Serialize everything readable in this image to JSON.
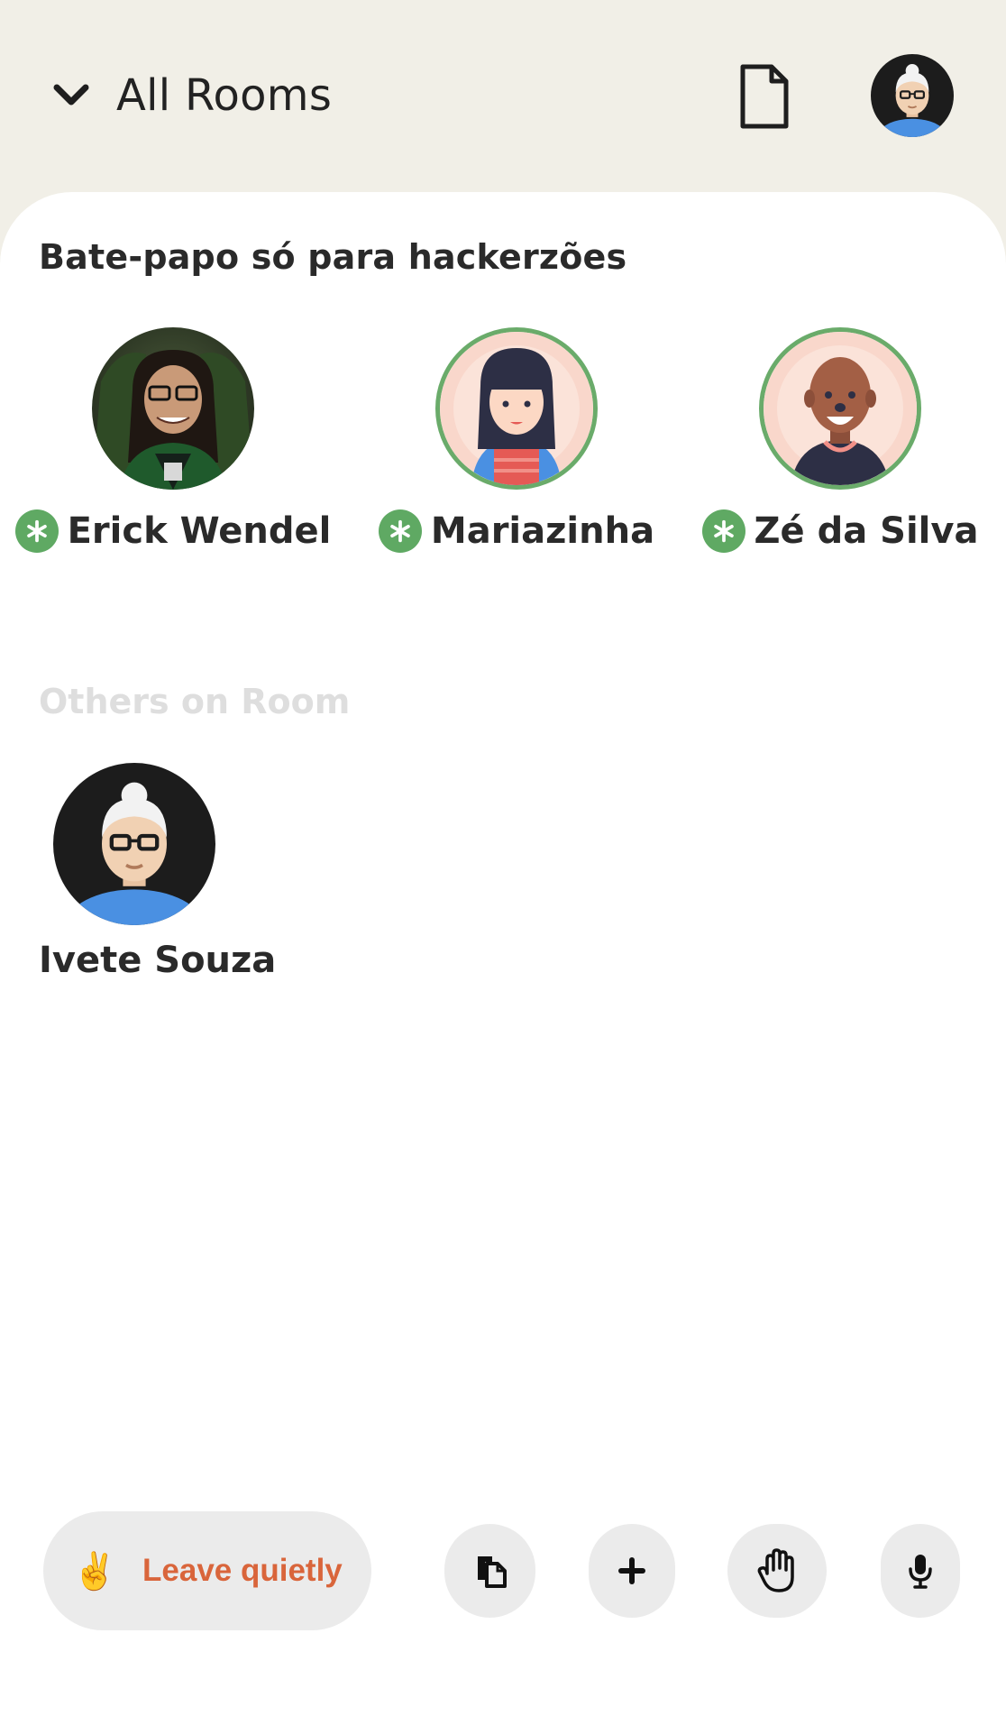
{
  "header": {
    "title": "All Rooms",
    "toggle_icon": "chevron-down-icon",
    "document_icon": "document-icon",
    "profile_avatar": "avatar-ivete-souza"
  },
  "room": {
    "title": "Bate-papo só para hackerzões",
    "speakers": [
      {
        "name": "Erick Wendel",
        "moderator": true
      },
      {
        "name": "Mariazinha",
        "moderator": true
      },
      {
        "name": "Zé da Silva",
        "moderator": true
      }
    ],
    "others_title": "Others on Room",
    "listeners": [
      {
        "name": "Ivete Souza"
      }
    ]
  },
  "toolbar": {
    "leave_emoji": "✌️",
    "leave_label": "Leave quietly",
    "buttons": [
      {
        "icon": "share-icon"
      },
      {
        "icon": "plus-icon"
      },
      {
        "icon": "raise-hand-icon"
      },
      {
        "icon": "microphone-icon"
      }
    ]
  },
  "colors": {
    "background": "#f1efe7",
    "card": "#ffffff",
    "moderator_green": "#5fa963",
    "ring_green": "#6aab6a",
    "leave_orange": "#d9653b",
    "button_gray": "#ebebeb"
  }
}
